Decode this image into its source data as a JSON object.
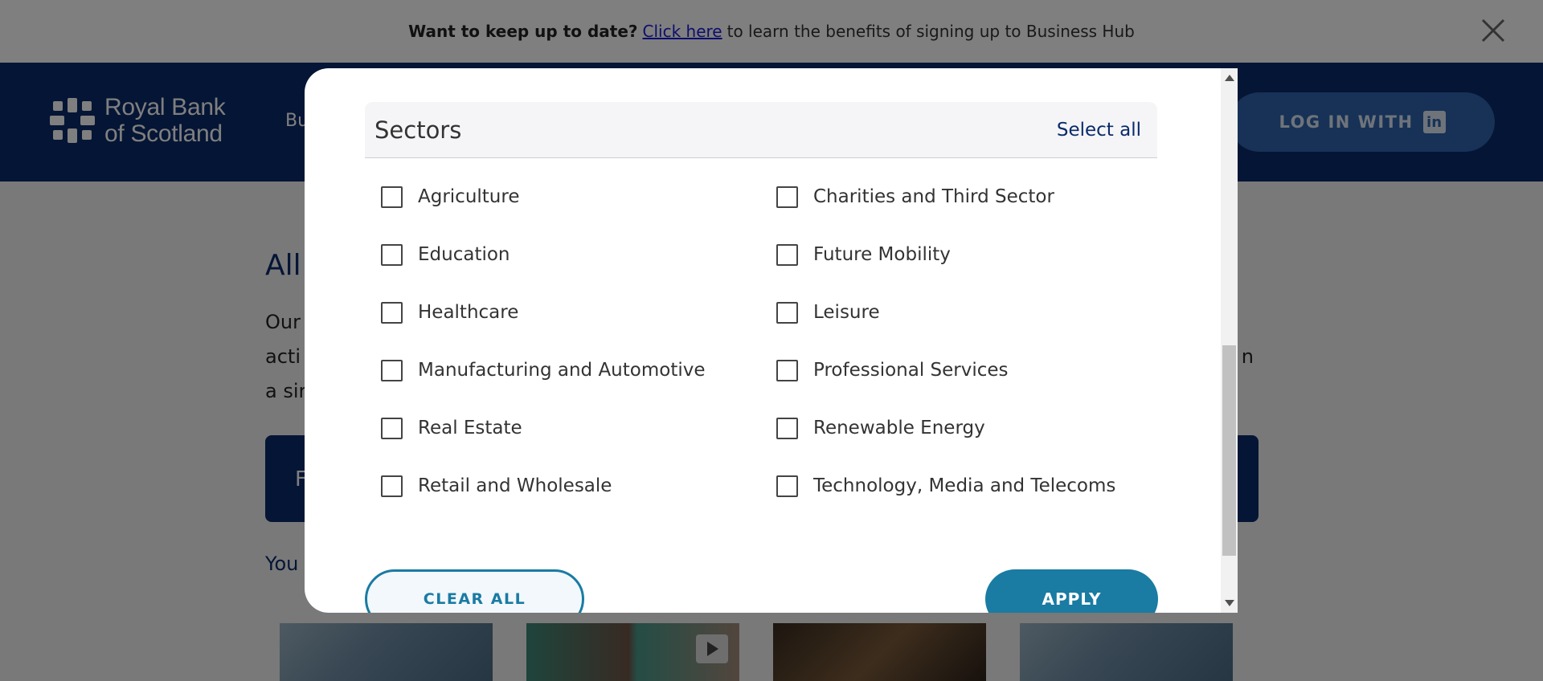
{
  "banner": {
    "bold_text": "Want to keep up to date?",
    "link_text": "Click here",
    "rest_text": "to learn the benefits of signing up to Business Hub"
  },
  "header": {
    "logo_line1": "Royal Bank",
    "logo_line2": "of Scotland",
    "nav_fragment": "Bu",
    "login_label": "LOG IN WITH",
    "login_icon_letter": "in"
  },
  "page": {
    "title_fragment": "All",
    "intro_line1_left": "Our",
    "intro_line2_left": "acti",
    "intro_line2_right": "n",
    "intro_line3_left": "a sin",
    "filter_fragment": "F",
    "you_fragment": "You"
  },
  "modal": {
    "section_title": "Sectors",
    "select_all": "Select all",
    "options": [
      "Agriculture",
      "Charities and Third Sector",
      "Education",
      "Future Mobility",
      "Healthcare",
      "Leisure",
      "Manufacturing and Automotive",
      "Professional Services",
      "Real Estate",
      "Renewable Energy",
      "Retail and Wholesale",
      "Technology, Media and Telecoms"
    ],
    "clear_all": "CLEAR ALL",
    "apply": "APPLY"
  },
  "colors": {
    "brand_navy": "#0a2a6a",
    "button_teal": "#1a7ba3",
    "login_blue": "#2f64ad"
  }
}
